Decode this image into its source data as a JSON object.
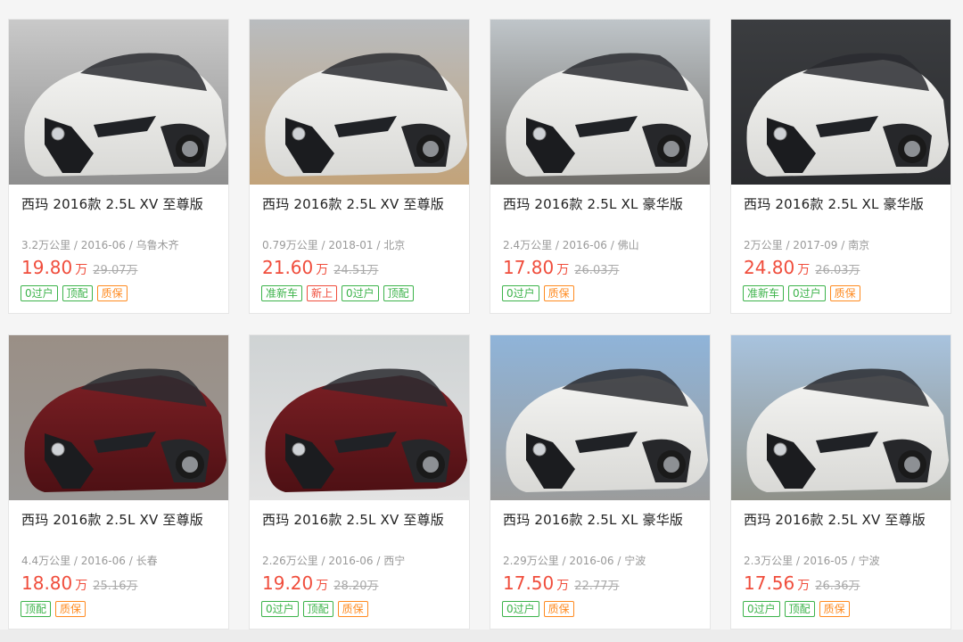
{
  "colors": {
    "price": "#f04d3c",
    "tag_green": "#3cb34a",
    "tag_orange": "#ff8a1f",
    "tag_red": "#f04d3c"
  },
  "cards": [
    {
      "title": "西玛 2016款 2.5L XV 至尊版",
      "meta": "3.2万公里 / 2016-06 / 乌鲁木齐",
      "price": "19.80",
      "unit": "万",
      "orig": "29.07万",
      "tags": [
        {
          "label": "0过户",
          "color": "green"
        },
        {
          "label": "顶配",
          "color": "green"
        },
        {
          "label": "质保",
          "color": "orange"
        }
      ],
      "car_color": "white"
    },
    {
      "title": "西玛 2016款 2.5L XV 至尊版",
      "meta": "0.79万公里 / 2018-01 / 北京",
      "price": "21.60",
      "unit": "万",
      "orig": "24.51万",
      "tags": [
        {
          "label": "准新车",
          "color": "green"
        },
        {
          "label": "新上",
          "color": "red"
        },
        {
          "label": "0过户",
          "color": "green"
        },
        {
          "label": "顶配",
          "color": "green"
        }
      ],
      "car_color": "white"
    },
    {
      "title": "西玛 2016款 2.5L XL 豪华版",
      "meta": "2.4万公里 / 2016-06 / 佛山",
      "price": "17.80",
      "unit": "万",
      "orig": "26.03万",
      "tags": [
        {
          "label": "0过户",
          "color": "green"
        },
        {
          "label": "质保",
          "color": "orange"
        }
      ],
      "car_color": "white"
    },
    {
      "title": "西玛 2016款 2.5L XL 豪华版",
      "meta": "2万公里 / 2017-09 / 南京",
      "price": "24.80",
      "unit": "万",
      "orig": "26.03万",
      "tags": [
        {
          "label": "准新车",
          "color": "green"
        },
        {
          "label": "0过户",
          "color": "green"
        },
        {
          "label": "质保",
          "color": "orange"
        }
      ],
      "car_color": "white"
    },
    {
      "title": "西玛 2016款 2.5L XV 至尊版",
      "meta": "4.4万公里 / 2016-06 / 长春",
      "price": "18.80",
      "unit": "万",
      "orig": "25.16万",
      "tags": [
        {
          "label": "顶配",
          "color": "green"
        },
        {
          "label": "质保",
          "color": "orange"
        }
      ],
      "car_color": "maroon"
    },
    {
      "title": "西玛 2016款 2.5L XV 至尊版",
      "meta": "2.26万公里 / 2016-06 / 西宁",
      "price": "19.20",
      "unit": "万",
      "orig": "28.20万",
      "tags": [
        {
          "label": "0过户",
          "color": "green"
        },
        {
          "label": "顶配",
          "color": "green"
        },
        {
          "label": "质保",
          "color": "orange"
        }
      ],
      "car_color": "maroon"
    },
    {
      "title": "西玛 2016款 2.5L XL 豪华版",
      "meta": "2.29万公里 / 2016-06 / 宁波",
      "price": "17.50",
      "unit": "万",
      "orig": "22.77万",
      "tags": [
        {
          "label": "0过户",
          "color": "green"
        },
        {
          "label": "质保",
          "color": "orange"
        }
      ],
      "car_color": "white"
    },
    {
      "title": "西玛 2016款 2.5L XV 至尊版",
      "meta": "2.3万公里 / 2016-05 / 宁波",
      "price": "17.56",
      "unit": "万",
      "orig": "26.36万",
      "tags": [
        {
          "label": "0过户",
          "color": "green"
        },
        {
          "label": "顶配",
          "color": "green"
        },
        {
          "label": "质保",
          "color": "orange"
        }
      ],
      "car_color": "white"
    }
  ]
}
